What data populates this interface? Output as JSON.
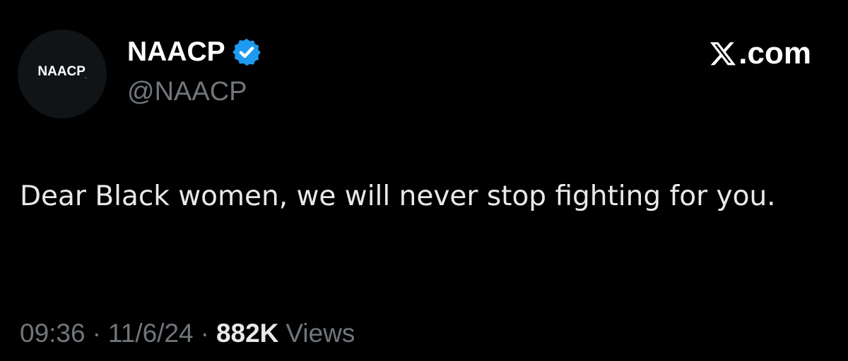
{
  "colors": {
    "background": "#000000",
    "primary_text": "#e7e9ea",
    "secondary_text": "#71767b",
    "verified_badge": "#1d9bf0"
  },
  "author": {
    "avatar_logo_text": "NAACP",
    "avatar_logo_mark": ".",
    "display_name": "NAACP",
    "handle": "@NAACP",
    "verified_icon": "verified-badge-icon"
  },
  "brand": {
    "icon": "x-logo-icon",
    "label": ".com"
  },
  "tweet": {
    "text": "Dear Black women, we will never stop fighting for you."
  },
  "meta": {
    "time": "09:36",
    "separator": "·",
    "date": "11/6/24",
    "views_count": "882K",
    "views_label": "Views"
  }
}
